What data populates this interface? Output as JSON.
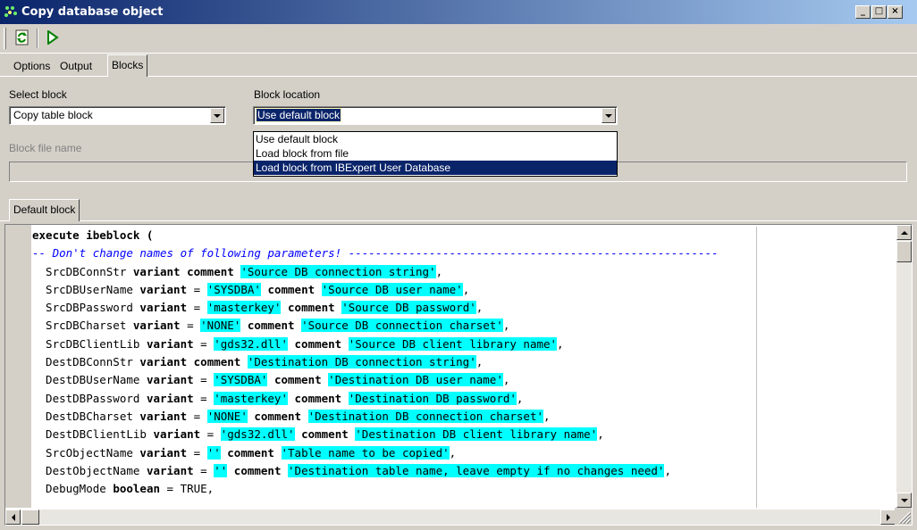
{
  "window": {
    "title": "Copy database object",
    "minimize_label": "_",
    "maximize_label": "□",
    "close_label": "×"
  },
  "toolbar": {
    "buttons": [
      {
        "name": "refresh-icon"
      },
      {
        "name": "run-icon"
      }
    ]
  },
  "tabs": [
    {
      "label": "Options",
      "active": false
    },
    {
      "label": "Output",
      "active": false
    },
    {
      "label": "Blocks",
      "active": true
    }
  ],
  "select_block": {
    "label": "Select block",
    "value": "Copy table block"
  },
  "block_location": {
    "label": "Block location",
    "value": "Use default block",
    "options": [
      {
        "label": "Use default block",
        "highlighted": false
      },
      {
        "label": "Load block from file",
        "highlighted": false
      },
      {
        "label": "Load block from IBExpert User Database",
        "highlighted": true
      }
    ]
  },
  "block_file_name": {
    "label": "Block file name",
    "value": ""
  },
  "subtabs": [
    {
      "label": "Default block",
      "active": true
    }
  ],
  "editor": {
    "lines": [
      [
        {
          "t": "execute ibeblock (",
          "s": "kw"
        }
      ],
      [
        {
          "t": "-- Don't change names of following parameters! -------------------------------------------------------",
          "s": "cm"
        }
      ],
      [
        {
          "t": "  SrcDBConnStr ",
          "s": ""
        },
        {
          "t": "variant",
          "s": "kw"
        },
        {
          "t": " ",
          "s": ""
        },
        {
          "t": "comment",
          "s": "kw"
        },
        {
          "t": " ",
          "s": ""
        },
        {
          "t": "'Source DB connection string'",
          "s": "str"
        },
        {
          "t": ",",
          "s": ""
        }
      ],
      [
        {
          "t": "  SrcDBUserName ",
          "s": ""
        },
        {
          "t": "variant",
          "s": "kw"
        },
        {
          "t": " = ",
          "s": ""
        },
        {
          "t": "'SYSDBA'",
          "s": "str"
        },
        {
          "t": " ",
          "s": ""
        },
        {
          "t": "comment",
          "s": "kw"
        },
        {
          "t": " ",
          "s": ""
        },
        {
          "t": "'Source DB user name'",
          "s": "str"
        },
        {
          "t": ",",
          "s": ""
        }
      ],
      [
        {
          "t": "  SrcDBPassword ",
          "s": ""
        },
        {
          "t": "variant",
          "s": "kw"
        },
        {
          "t": " = ",
          "s": ""
        },
        {
          "t": "'masterkey'",
          "s": "str"
        },
        {
          "t": " ",
          "s": ""
        },
        {
          "t": "comment",
          "s": "kw"
        },
        {
          "t": " ",
          "s": ""
        },
        {
          "t": "'Source DB password'",
          "s": "str"
        },
        {
          "t": ",",
          "s": ""
        }
      ],
      [
        {
          "t": "  SrcDBCharset ",
          "s": ""
        },
        {
          "t": "variant",
          "s": "kw"
        },
        {
          "t": " = ",
          "s": ""
        },
        {
          "t": "'NONE'",
          "s": "str"
        },
        {
          "t": " ",
          "s": ""
        },
        {
          "t": "comment",
          "s": "kw"
        },
        {
          "t": " ",
          "s": ""
        },
        {
          "t": "'Source DB connection charset'",
          "s": "str"
        },
        {
          "t": ",",
          "s": ""
        }
      ],
      [
        {
          "t": "  SrcDBClientLib ",
          "s": ""
        },
        {
          "t": "variant",
          "s": "kw"
        },
        {
          "t": " = ",
          "s": ""
        },
        {
          "t": "'gds32.dll'",
          "s": "str"
        },
        {
          "t": " ",
          "s": ""
        },
        {
          "t": "comment",
          "s": "kw"
        },
        {
          "t": " ",
          "s": ""
        },
        {
          "t": "'Source DB client library name'",
          "s": "str"
        },
        {
          "t": ",",
          "s": ""
        }
      ],
      [
        {
          "t": "  DestDBConnStr ",
          "s": ""
        },
        {
          "t": "variant",
          "s": "kw"
        },
        {
          "t": " ",
          "s": ""
        },
        {
          "t": "comment",
          "s": "kw"
        },
        {
          "t": " ",
          "s": ""
        },
        {
          "t": "'Destination DB connection string'",
          "s": "str"
        },
        {
          "t": ",",
          "s": ""
        }
      ],
      [
        {
          "t": "  DestDBUserName ",
          "s": ""
        },
        {
          "t": "variant",
          "s": "kw"
        },
        {
          "t": " = ",
          "s": ""
        },
        {
          "t": "'SYSDBA'",
          "s": "str"
        },
        {
          "t": " ",
          "s": ""
        },
        {
          "t": "comment",
          "s": "kw"
        },
        {
          "t": " ",
          "s": ""
        },
        {
          "t": "'Destination DB user name'",
          "s": "str"
        },
        {
          "t": ",",
          "s": ""
        }
      ],
      [
        {
          "t": "  DestDBPassword ",
          "s": ""
        },
        {
          "t": "variant",
          "s": "kw"
        },
        {
          "t": " = ",
          "s": ""
        },
        {
          "t": "'masterkey'",
          "s": "str"
        },
        {
          "t": " ",
          "s": ""
        },
        {
          "t": "comment",
          "s": "kw"
        },
        {
          "t": " ",
          "s": ""
        },
        {
          "t": "'Destination DB password'",
          "s": "str"
        },
        {
          "t": ",",
          "s": ""
        }
      ],
      [
        {
          "t": "  DestDBCharset ",
          "s": ""
        },
        {
          "t": "variant",
          "s": "kw"
        },
        {
          "t": " = ",
          "s": ""
        },
        {
          "t": "'NONE'",
          "s": "str"
        },
        {
          "t": " ",
          "s": ""
        },
        {
          "t": "comment",
          "s": "kw"
        },
        {
          "t": " ",
          "s": ""
        },
        {
          "t": "'Destination DB connection charset'",
          "s": "str"
        },
        {
          "t": ",",
          "s": ""
        }
      ],
      [
        {
          "t": "  DestDBClientLib ",
          "s": ""
        },
        {
          "t": "variant",
          "s": "kw"
        },
        {
          "t": " = ",
          "s": ""
        },
        {
          "t": "'gds32.dll'",
          "s": "str"
        },
        {
          "t": " ",
          "s": ""
        },
        {
          "t": "comment",
          "s": "kw"
        },
        {
          "t": " ",
          "s": ""
        },
        {
          "t": "'Destination DB client library name'",
          "s": "str"
        },
        {
          "t": ",",
          "s": ""
        }
      ],
      [
        {
          "t": "  SrcObjectName ",
          "s": ""
        },
        {
          "t": "variant",
          "s": "kw"
        },
        {
          "t": " = ",
          "s": ""
        },
        {
          "t": "''",
          "s": "str"
        },
        {
          "t": " ",
          "s": ""
        },
        {
          "t": "comment",
          "s": "kw"
        },
        {
          "t": " ",
          "s": ""
        },
        {
          "t": "'Table name to be copied'",
          "s": "str"
        },
        {
          "t": ",",
          "s": ""
        }
      ],
      [
        {
          "t": "  DestObjectName ",
          "s": ""
        },
        {
          "t": "variant",
          "s": "kw"
        },
        {
          "t": " = ",
          "s": ""
        },
        {
          "t": "''",
          "s": "str"
        },
        {
          "t": " ",
          "s": ""
        },
        {
          "t": "comment",
          "s": "kw"
        },
        {
          "t": " ",
          "s": ""
        },
        {
          "t": "'Destination table name, leave empty if no changes need'",
          "s": "str"
        },
        {
          "t": ",",
          "s": ""
        }
      ],
      [
        {
          "t": "  DebugMode ",
          "s": ""
        },
        {
          "t": "boolean",
          "s": "kw"
        },
        {
          "t": " = TRUE,",
          "s": ""
        }
      ]
    ]
  },
  "colors": {
    "face": "#d4d0c8",
    "title_start": "#0a246a",
    "title_end": "#a6caf0",
    "string_highlight": "#00ffff",
    "comment": "#0000ff",
    "selection": "#0a246a"
  }
}
